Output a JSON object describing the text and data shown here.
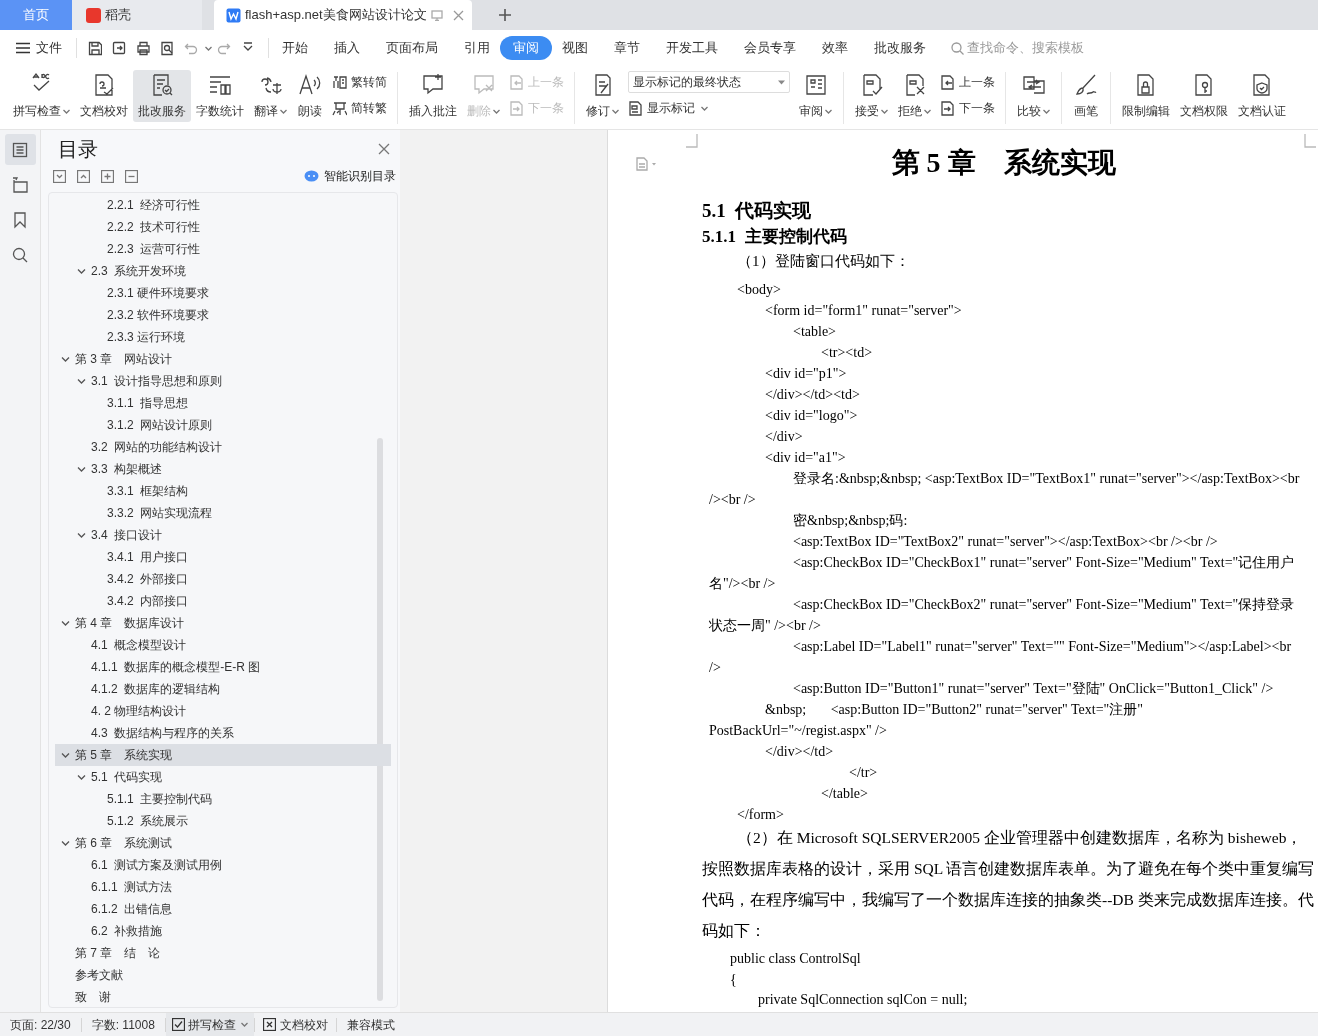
{
  "tabs": [
    {
      "label": "首页",
      "kind": "home",
      "selected": false
    },
    {
      "label": "稻壳",
      "kind": "app",
      "selected": false
    },
    {
      "label": "flash+asp.net美食网站设计论文",
      "kind": "doc",
      "selected": true
    }
  ],
  "menu": {
    "file": "文件",
    "tabs": [
      {
        "label": "开始",
        "selected": false
      },
      {
        "label": "插入",
        "selected": false
      },
      {
        "label": "页面布局",
        "selected": false
      },
      {
        "label": "引用",
        "selected": false
      },
      {
        "label": "审阅",
        "selected": true
      },
      {
        "label": "视图",
        "selected": false
      },
      {
        "label": "章节",
        "selected": false
      },
      {
        "label": "开发工具",
        "selected": false
      },
      {
        "label": "会员专享",
        "selected": false
      },
      {
        "label": "效率",
        "selected": false
      },
      {
        "label": "批改服务",
        "selected": false
      }
    ],
    "search": {
      "placeholder": "查找命令、搜索模板"
    }
  },
  "ribbon": [
    {
      "items": [
        {
          "kind": "big",
          "label": "拼写检查",
          "dropdown": true,
          "disabled": false,
          "highlighted": false
        },
        {
          "kind": "big",
          "label": "文档校对",
          "dropdown": false,
          "disabled": false,
          "highlighted": false
        },
        {
          "kind": "big",
          "label": "批改服务",
          "dropdown": false,
          "disabled": false,
          "highlighted": true
        },
        {
          "kind": "big",
          "label": "字数统计",
          "dropdown": false,
          "disabled": false,
          "highlighted": false
        },
        {
          "kind": "big",
          "label": "翻译",
          "dropdown": true,
          "disabled": false,
          "highlighted": false
        },
        {
          "kind": "big",
          "label": "朗读",
          "dropdown": false,
          "disabled": false,
          "highlighted": false
        },
        {
          "kind": "stack",
          "items": [
            {
              "kind": "small",
              "label": "繁转简",
              "dropdown": false,
              "disabled": false
            },
            {
              "kind": "small",
              "label": "简转繁",
              "dropdown": false,
              "disabled": false
            }
          ]
        }
      ]
    },
    {
      "items": [
        {
          "kind": "big",
          "label": "插入批注",
          "dropdown": false,
          "disabled": false,
          "highlighted": false
        },
        {
          "kind": "big",
          "label": "删除",
          "dropdown": true,
          "disabled": true,
          "highlighted": false
        },
        {
          "kind": "stack",
          "items": [
            {
              "kind": "small",
              "label": "上一条",
              "dropdown": false,
              "disabled": true
            },
            {
              "kind": "small",
              "label": "下一条",
              "dropdown": false,
              "disabled": true
            }
          ]
        }
      ]
    },
    {
      "items": [
        {
          "kind": "big",
          "label": "修订",
          "dropdown": true,
          "disabled": false,
          "highlighted": false
        },
        {
          "kind": "stack",
          "items": [
            {
              "kind": "select",
              "label": "显示标记的最终状态",
              "dropdown": true,
              "disabled": false
            },
            {
              "kind": "small",
              "label": "显示标记",
              "dropdown": true,
              "disabled": false
            }
          ]
        },
        {
          "kind": "big",
          "label": "审阅",
          "dropdown": true,
          "disabled": false,
          "highlighted": false
        }
      ]
    },
    {
      "items": [
        {
          "kind": "big",
          "label": "接受",
          "dropdown": true,
          "disabled": false,
          "highlighted": false
        },
        {
          "kind": "big",
          "label": "拒绝",
          "dropdown": true,
          "disabled": false,
          "highlighted": false
        },
        {
          "kind": "stack",
          "items": [
            {
              "kind": "small",
              "label": "上一条",
              "dropdown": false,
              "disabled": false
            },
            {
              "kind": "small",
              "label": "下一条",
              "dropdown": false,
              "disabled": false
            }
          ]
        }
      ]
    },
    {
      "items": [
        {
          "kind": "big",
          "label": "比较",
          "dropdown": true,
          "disabled": false,
          "highlighted": false
        }
      ]
    },
    {
      "items": [
        {
          "kind": "big",
          "label": "画笔",
          "dropdown": false,
          "disabled": false,
          "highlighted": false
        }
      ]
    },
    {
      "items": [
        {
          "kind": "big",
          "label": "限制编辑",
          "dropdown": false,
          "disabled": false,
          "highlighted": false
        },
        {
          "kind": "big",
          "label": "文档权限",
          "dropdown": false,
          "disabled": false,
          "highlighted": false
        },
        {
          "kind": "big",
          "label": "文档认证",
          "dropdown": false,
          "disabled": false,
          "highlighted": false
        }
      ]
    }
  ],
  "nav_icons": [
    {
      "selected": true
    },
    {
      "selected": false
    },
    {
      "selected": false
    },
    {
      "selected": false
    }
  ],
  "toc": {
    "title": "目录",
    "smart_button": "智能识别目录",
    "items": [
      {
        "children": [
          {
            "children": [
              {
                "label": "2.2.1  经济可行性",
                "selected": false
              },
              {
                "label": "2.2.2  技术可行性",
                "selected": false
              },
              {
                "label": "2.2.3  运营可行性",
                "selected": false
              }
            ]
          },
          {
            "label": "2.3  系统开发环境",
            "selected": false,
            "expanded": true,
            "children": [
              {
                "label": "2.3.1 硬件环境要求",
                "selected": false
              },
              {
                "label": "2.3.2 软件环境要求",
                "selected": false
              },
              {
                "label": "2.3.3 运行环境",
                "selected": false
              }
            ]
          }
        ]
      },
      {
        "label": "第 3 章　网站设计",
        "selected": false,
        "expanded": true,
        "children": [
          {
            "label": "3.1  设计指导思想和原则",
            "selected": false,
            "expanded": true,
            "children": [
              {
                "label": "3.1.1  指导思想",
                "selected": false
              },
              {
                "label": "3.1.2  网站设计原则",
                "selected": false
              }
            ]
          },
          {
            "label": "3.2  网站的功能结构设计",
            "selected": false
          },
          {
            "label": "3.3  构架概述",
            "selected": false,
            "expanded": true,
            "children": [
              {
                "label": "3.3.1  框架结构",
                "selected": false
              },
              {
                "label": "3.3.2  网站实现流程",
                "selected": false
              }
            ]
          },
          {
            "label": "3.4  接口设计",
            "selected": false,
            "expanded": true,
            "children": [
              {
                "label": "3.4.1  用户接口",
                "selected": false
              },
              {
                "label": "3.4.2  外部接口",
                "selected": false
              },
              {
                "label": "3.4.2  内部接口",
                "selected": false
              }
            ]
          }
        ]
      },
      {
        "label": "第 4 章　数据库设计",
        "selected": false,
        "expanded": true,
        "children": [
          {
            "label": "4.1  概念模型设计",
            "selected": false
          },
          {
            "label": "4.1.1  数据库的概念模型-E-R 图",
            "selected": false
          },
          {
            "label": "4.1.2  数据库的逻辑结构",
            "selected": false
          },
          {
            "label": "4. 2 物理结构设计",
            "selected": false
          },
          {
            "label": "4.3  数据结构与程序的关系",
            "selected": false
          }
        ]
      },
      {
        "label": "第 5 章　系统实现",
        "selected": true,
        "expanded": true,
        "children": [
          {
            "label": "5.1  代码实现",
            "selected": false,
            "expanded": true,
            "children": [
              {
                "label": "5.1.1  主要控制代码",
                "selected": false
              },
              {
                "label": "5.1.2  系统展示",
                "selected": false
              }
            ]
          }
        ]
      },
      {
        "label": "第 6 章　系统测试",
        "selected": false,
        "expanded": true,
        "children": [
          {
            "label": "6.1  测试方案及测试用例",
            "selected": false
          },
          {
            "label": "6.1.1  测试方法",
            "selected": false
          },
          {
            "label": "6.1.2  出错信息",
            "selected": false
          },
          {
            "label": "6.2  补救措施",
            "selected": false
          }
        ]
      },
      {
        "label": "第 7 章　结　论",
        "selected": false
      },
      {
        "label": "参考文献",
        "selected": false
      },
      {
        "label": "致　谢",
        "selected": false
      }
    ]
  },
  "document": {
    "chapter_title": "第 5 章　系统实现",
    "heading_1": "5.1  代码实现",
    "heading_2": "5.1.1  主要控制代码",
    "intro": "（1）登陆窗口代码如下：",
    "lines": [
      {
        "kind": "i1",
        "text": "<body>"
      },
      {
        "kind": "i2",
        "text": "<form id=\"form1\" runat=\"server\">"
      },
      {
        "kind": "i3",
        "text": "<table>"
      },
      {
        "kind": "i4",
        "text": "<tr><td>"
      },
      {
        "kind": "i2",
        "text": "<div id=\"p1\">"
      },
      {
        "kind": "i2",
        "text": "</div></td><td>"
      },
      {
        "kind": "i2",
        "text": "<div id=\"logo\">"
      },
      {
        "kind": "i2",
        "text": "</div>"
      },
      {
        "kind": "i2",
        "text": "<div id=\"a1\">"
      },
      {
        "kind": "i3",
        "text": "登录名:&nbsp;&nbsp; <asp:TextBox ID=\"TextBox1\" runat=\"server\"></asp:TextBox><br"
      },
      {
        "kind": "i0",
        "text": "/><br />"
      },
      {
        "kind": "i3",
        "text": "密&nbsp;&nbsp;码:"
      },
      {
        "kind": "i3",
        "text": "<asp:TextBox ID=\"TextBox2\" runat=\"server\"></asp:TextBox><br /><br />"
      },
      {
        "kind": "i3",
        "text": "<asp:CheckBox ID=\"CheckBox1\" runat=\"server\" Font-Size=\"Medium\" Text=\"记住用户"
      },
      {
        "kind": "i0",
        "text": "名\"/><br />"
      },
      {
        "kind": "i3",
        "text": "<asp:CheckBox ID=\"CheckBox2\" runat=\"server\" Font-Size=\"Medium\" Text=\"保持登录"
      },
      {
        "kind": "i0",
        "text": "状态一周\" /><br />"
      },
      {
        "kind": "i3",
        "text": "<asp:Label ID=\"Label1\" runat=\"server\" Text=\"\" Font-Size=\"Medium\"></asp:Label><br"
      },
      {
        "kind": "i0",
        "text": "/>"
      },
      {
        "kind": "i3",
        "text": "<asp:Button ID=\"Button1\" runat=\"server\" Text=\"登陆\" OnClick=\"Button1_Click\" />"
      },
      {
        "kind": "i2",
        "text": "&nbsp;       <asp:Button ID=\"Button2\" runat=\"server\" Text=\"注册\""
      },
      {
        "kind": "i0",
        "text": "PostBackUrl=\"~/regist.aspx\" />"
      },
      {
        "kind": "i2",
        "text": "</div></td>"
      },
      {
        "kind": "i5",
        "text": "</tr>"
      },
      {
        "kind": "i4",
        "text": "</table>"
      },
      {
        "kind": "i1",
        "text": "</form>"
      },
      {
        "kind": "para_first",
        "text": "（2）在 Microsoft SQLSERVER2005 企业管理器中创建数据库，名称为 bisheweb，"
      },
      {
        "kind": "para",
        "text": "按照数据库表格的设计，采用 SQL 语言创建数据库表单。为了避免在每个类中重复编写"
      },
      {
        "kind": "para",
        "text": "代码，在程序编写中，我编写了一个数据库连接的抽象类--DB 类来完成数据库连接。代"
      },
      {
        "kind": "para",
        "text": "码如下："
      },
      {
        "kind": "c1",
        "text": "public class ControlSql"
      },
      {
        "kind": "c1",
        "text": "{"
      },
      {
        "kind": "c2",
        "text": "private SqlConnection sqlCon = null;"
      }
    ]
  },
  "status_bar": [
    {
      "kind": "text",
      "label": "页面: 22/30"
    },
    {
      "kind": "text",
      "label": "字数: 11008"
    },
    {
      "kind": "spell",
      "label": "拼写检查"
    },
    {
      "kind": "proof",
      "label": "文档校对"
    },
    {
      "kind": "text",
      "label": "兼容模式"
    }
  ]
}
